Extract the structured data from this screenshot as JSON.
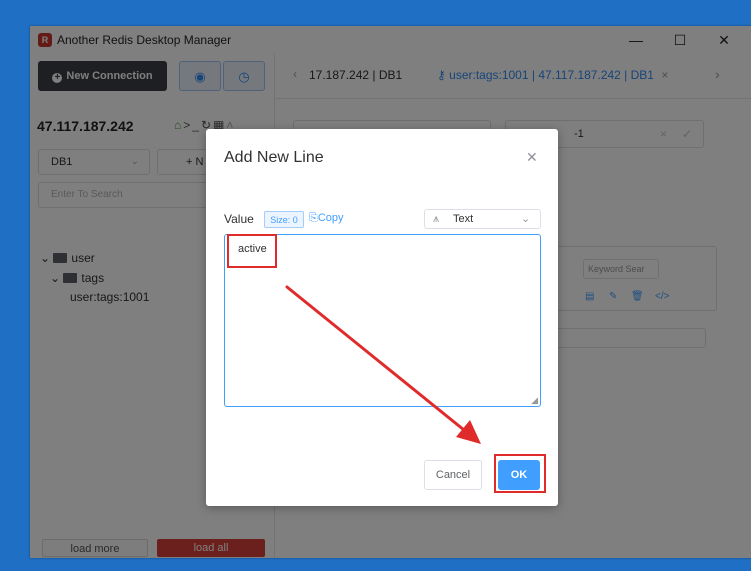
{
  "window": {
    "title": "Another Redis Desktop Manager",
    "minimize": "—",
    "maximize": "☐",
    "close": "✕"
  },
  "sidebar": {
    "new_connection_label": "New Connection",
    "host": "47.117.187.242",
    "db_value": "DB1",
    "new_key_label": "+ N",
    "search_placeholder": "Enter To Search",
    "tree": {
      "folder1": "user",
      "folder2": "tags",
      "key": "user:tags:1001"
    },
    "load_more": "load more",
    "load_all": "load all"
  },
  "tabs": {
    "tab1": "17.187.242 | DB1",
    "tab2": "user:tags:1001 | 47.117.187.242 | DB1"
  },
  "main": {
    "ttl_value": "-1",
    "keyword_search_placeholder": "Keyword Sear"
  },
  "dialog": {
    "title": "Add New Line",
    "value_label": "Value",
    "size_badge": "Size: 0",
    "copy_label": "Copy",
    "format_value": "Text",
    "textarea_value": "active",
    "cancel_label": "Cancel",
    "ok_label": "OK"
  },
  "colors": {
    "accent": "#409eff",
    "annotation_red": "#e02b2b",
    "danger": "#d9403a"
  }
}
